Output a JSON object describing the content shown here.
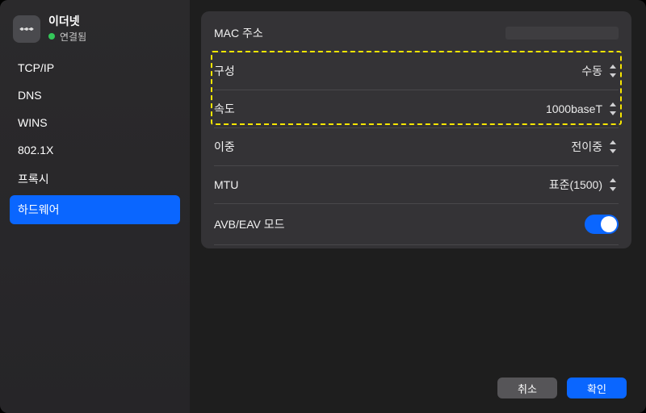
{
  "connection": {
    "name": "이더넷",
    "status": "연결됨"
  },
  "sidebar": {
    "items": [
      {
        "label": "TCP/IP",
        "selected": false
      },
      {
        "label": "DNS",
        "selected": false
      },
      {
        "label": "WINS",
        "selected": false
      },
      {
        "label": "802.1X",
        "selected": false
      },
      {
        "label": "프록시",
        "selected": false
      },
      {
        "label": "하드웨어",
        "selected": true
      }
    ]
  },
  "hardware": {
    "mac_label": "MAC 주소",
    "config_label": "구성",
    "config_value": "수동",
    "speed_label": "속도",
    "speed_value": "1000baseT",
    "duplex_label": "이중",
    "duplex_value": "전이중",
    "mtu_label": "MTU",
    "mtu_value": "표준(1500)",
    "avb_label": "AVB/EAV 모드",
    "avb_on": true
  },
  "footer": {
    "cancel": "취소",
    "ok": "확인"
  }
}
